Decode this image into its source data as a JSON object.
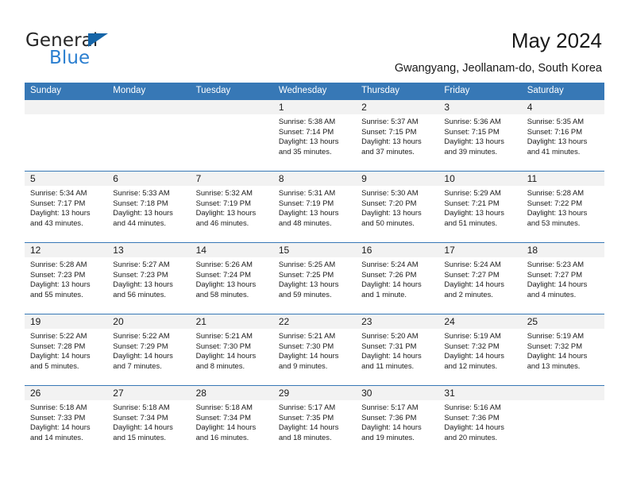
{
  "brand": {
    "name_part1": "General",
    "name_part2": "Blue",
    "triangle_color": "#1565a8",
    "blue_color": "#2b7fd0"
  },
  "header": {
    "title": "May 2024",
    "subtitle": "Gwangyang, Jeollanam-do, South Korea",
    "header_bg": "#3778b6"
  },
  "weekday_headers": [
    "Sunday",
    "Monday",
    "Tuesday",
    "Wednesday",
    "Thursday",
    "Friday",
    "Saturday"
  ],
  "weeks": [
    [
      {
        "day": "",
        "sunrise": "",
        "sunset": "",
        "daylight_line1": "",
        "daylight_line2": ""
      },
      {
        "day": "",
        "sunrise": "",
        "sunset": "",
        "daylight_line1": "",
        "daylight_line2": ""
      },
      {
        "day": "",
        "sunrise": "",
        "sunset": "",
        "daylight_line1": "",
        "daylight_line2": ""
      },
      {
        "day": "1",
        "sunrise": "Sunrise: 5:38 AM",
        "sunset": "Sunset: 7:14 PM",
        "daylight_line1": "Daylight: 13 hours",
        "daylight_line2": "and 35 minutes."
      },
      {
        "day": "2",
        "sunrise": "Sunrise: 5:37 AM",
        "sunset": "Sunset: 7:15 PM",
        "daylight_line1": "Daylight: 13 hours",
        "daylight_line2": "and 37 minutes."
      },
      {
        "day": "3",
        "sunrise": "Sunrise: 5:36 AM",
        "sunset": "Sunset: 7:15 PM",
        "daylight_line1": "Daylight: 13 hours",
        "daylight_line2": "and 39 minutes."
      },
      {
        "day": "4",
        "sunrise": "Sunrise: 5:35 AM",
        "sunset": "Sunset: 7:16 PM",
        "daylight_line1": "Daylight: 13 hours",
        "daylight_line2": "and 41 minutes."
      }
    ],
    [
      {
        "day": "5",
        "sunrise": "Sunrise: 5:34 AM",
        "sunset": "Sunset: 7:17 PM",
        "daylight_line1": "Daylight: 13 hours",
        "daylight_line2": "and 43 minutes."
      },
      {
        "day": "6",
        "sunrise": "Sunrise: 5:33 AM",
        "sunset": "Sunset: 7:18 PM",
        "daylight_line1": "Daylight: 13 hours",
        "daylight_line2": "and 44 minutes."
      },
      {
        "day": "7",
        "sunrise": "Sunrise: 5:32 AM",
        "sunset": "Sunset: 7:19 PM",
        "daylight_line1": "Daylight: 13 hours",
        "daylight_line2": "and 46 minutes."
      },
      {
        "day": "8",
        "sunrise": "Sunrise: 5:31 AM",
        "sunset": "Sunset: 7:19 PM",
        "daylight_line1": "Daylight: 13 hours",
        "daylight_line2": "and 48 minutes."
      },
      {
        "day": "9",
        "sunrise": "Sunrise: 5:30 AM",
        "sunset": "Sunset: 7:20 PM",
        "daylight_line1": "Daylight: 13 hours",
        "daylight_line2": "and 50 minutes."
      },
      {
        "day": "10",
        "sunrise": "Sunrise: 5:29 AM",
        "sunset": "Sunset: 7:21 PM",
        "daylight_line1": "Daylight: 13 hours",
        "daylight_line2": "and 51 minutes."
      },
      {
        "day": "11",
        "sunrise": "Sunrise: 5:28 AM",
        "sunset": "Sunset: 7:22 PM",
        "daylight_line1": "Daylight: 13 hours",
        "daylight_line2": "and 53 minutes."
      }
    ],
    [
      {
        "day": "12",
        "sunrise": "Sunrise: 5:28 AM",
        "sunset": "Sunset: 7:23 PM",
        "daylight_line1": "Daylight: 13 hours",
        "daylight_line2": "and 55 minutes."
      },
      {
        "day": "13",
        "sunrise": "Sunrise: 5:27 AM",
        "sunset": "Sunset: 7:23 PM",
        "daylight_line1": "Daylight: 13 hours",
        "daylight_line2": "and 56 minutes."
      },
      {
        "day": "14",
        "sunrise": "Sunrise: 5:26 AM",
        "sunset": "Sunset: 7:24 PM",
        "daylight_line1": "Daylight: 13 hours",
        "daylight_line2": "and 58 minutes."
      },
      {
        "day": "15",
        "sunrise": "Sunrise: 5:25 AM",
        "sunset": "Sunset: 7:25 PM",
        "daylight_line1": "Daylight: 13 hours",
        "daylight_line2": "and 59 minutes."
      },
      {
        "day": "16",
        "sunrise": "Sunrise: 5:24 AM",
        "sunset": "Sunset: 7:26 PM",
        "daylight_line1": "Daylight: 14 hours",
        "daylight_line2": "and 1 minute."
      },
      {
        "day": "17",
        "sunrise": "Sunrise: 5:24 AM",
        "sunset": "Sunset: 7:27 PM",
        "daylight_line1": "Daylight: 14 hours",
        "daylight_line2": "and 2 minutes."
      },
      {
        "day": "18",
        "sunrise": "Sunrise: 5:23 AM",
        "sunset": "Sunset: 7:27 PM",
        "daylight_line1": "Daylight: 14 hours",
        "daylight_line2": "and 4 minutes."
      }
    ],
    [
      {
        "day": "19",
        "sunrise": "Sunrise: 5:22 AM",
        "sunset": "Sunset: 7:28 PM",
        "daylight_line1": "Daylight: 14 hours",
        "daylight_line2": "and 5 minutes."
      },
      {
        "day": "20",
        "sunrise": "Sunrise: 5:22 AM",
        "sunset": "Sunset: 7:29 PM",
        "daylight_line1": "Daylight: 14 hours",
        "daylight_line2": "and 7 minutes."
      },
      {
        "day": "21",
        "sunrise": "Sunrise: 5:21 AM",
        "sunset": "Sunset: 7:30 PM",
        "daylight_line1": "Daylight: 14 hours",
        "daylight_line2": "and 8 minutes."
      },
      {
        "day": "22",
        "sunrise": "Sunrise: 5:21 AM",
        "sunset": "Sunset: 7:30 PM",
        "daylight_line1": "Daylight: 14 hours",
        "daylight_line2": "and 9 minutes."
      },
      {
        "day": "23",
        "sunrise": "Sunrise: 5:20 AM",
        "sunset": "Sunset: 7:31 PM",
        "daylight_line1": "Daylight: 14 hours",
        "daylight_line2": "and 11 minutes."
      },
      {
        "day": "24",
        "sunrise": "Sunrise: 5:19 AM",
        "sunset": "Sunset: 7:32 PM",
        "daylight_line1": "Daylight: 14 hours",
        "daylight_line2": "and 12 minutes."
      },
      {
        "day": "25",
        "sunrise": "Sunrise: 5:19 AM",
        "sunset": "Sunset: 7:32 PM",
        "daylight_line1": "Daylight: 14 hours",
        "daylight_line2": "and 13 minutes."
      }
    ],
    [
      {
        "day": "26",
        "sunrise": "Sunrise: 5:18 AM",
        "sunset": "Sunset: 7:33 PM",
        "daylight_line1": "Daylight: 14 hours",
        "daylight_line2": "and 14 minutes."
      },
      {
        "day": "27",
        "sunrise": "Sunrise: 5:18 AM",
        "sunset": "Sunset: 7:34 PM",
        "daylight_line1": "Daylight: 14 hours",
        "daylight_line2": "and 15 minutes."
      },
      {
        "day": "28",
        "sunrise": "Sunrise: 5:18 AM",
        "sunset": "Sunset: 7:34 PM",
        "daylight_line1": "Daylight: 14 hours",
        "daylight_line2": "and 16 minutes."
      },
      {
        "day": "29",
        "sunrise": "Sunrise: 5:17 AM",
        "sunset": "Sunset: 7:35 PM",
        "daylight_line1": "Daylight: 14 hours",
        "daylight_line2": "and 18 minutes."
      },
      {
        "day": "30",
        "sunrise": "Sunrise: 5:17 AM",
        "sunset": "Sunset: 7:36 PM",
        "daylight_line1": "Daylight: 14 hours",
        "daylight_line2": "and 19 minutes."
      },
      {
        "day": "31",
        "sunrise": "Sunrise: 5:16 AM",
        "sunset": "Sunset: 7:36 PM",
        "daylight_line1": "Daylight: 14 hours",
        "daylight_line2": "and 20 minutes."
      },
      {
        "day": "",
        "sunrise": "",
        "sunset": "",
        "daylight_line1": "",
        "daylight_line2": ""
      }
    ]
  ]
}
